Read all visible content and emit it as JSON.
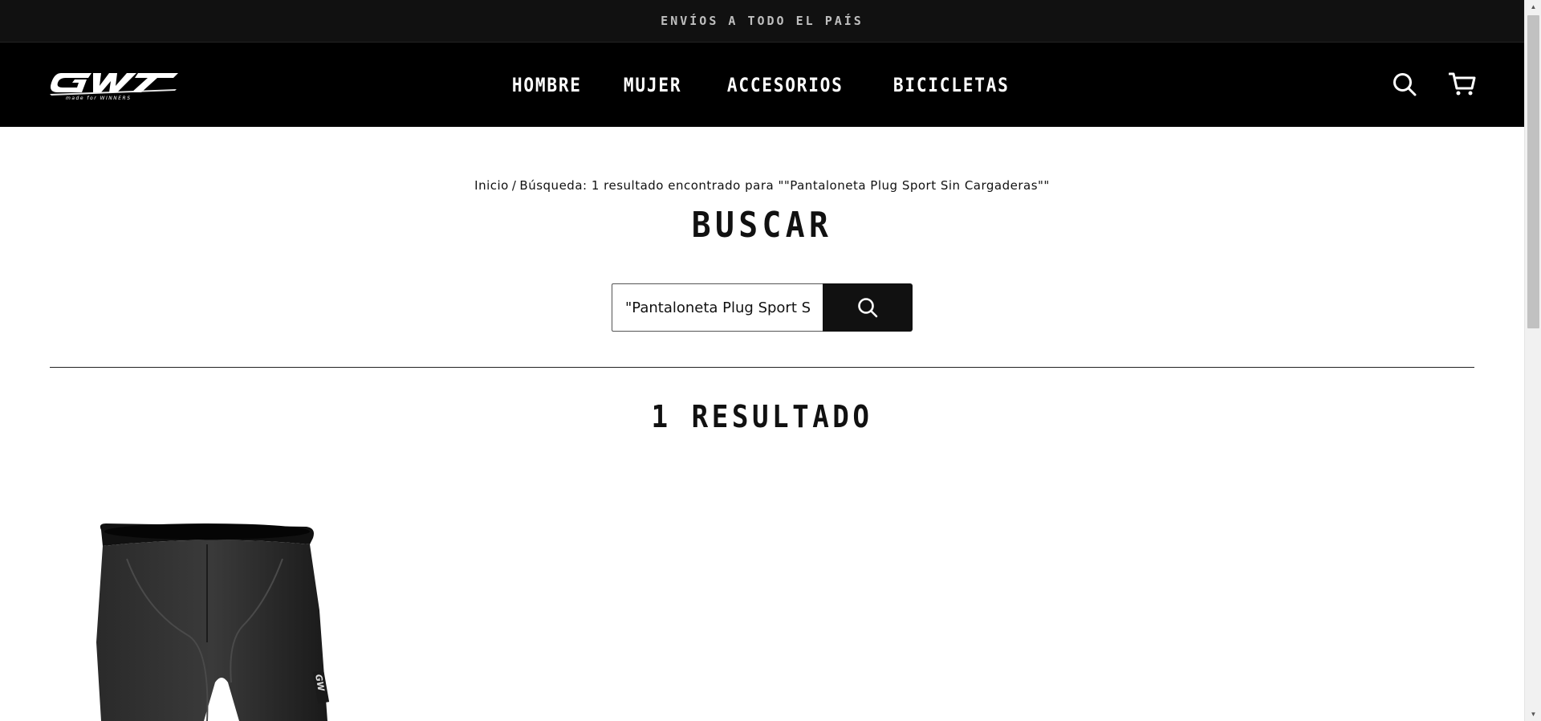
{
  "announcement": {
    "text": "ENVÍOS A TODO EL PAÍS"
  },
  "header": {
    "logo_text": "GW",
    "logo_tagline": "made for WINNERS",
    "nav": [
      {
        "label": "HOMBRE"
      },
      {
        "label": "MUJER"
      },
      {
        "label": "ACCESORIOS"
      },
      {
        "label": "BICICLETAS"
      }
    ],
    "icons": [
      "search-icon",
      "cart-icon"
    ]
  },
  "breadcrumb": {
    "home": "Inicio",
    "separator": "/",
    "current": "Búsqueda: 1 resultado encontrado para \"\"Pantaloneta Plug Sport Sin Cargaderas\"\""
  },
  "main": {
    "title": "BUSCAR",
    "search": {
      "value": "\"Pantaloneta Plug Sport Sin Cargaderas\"",
      "submit_icon": "search-icon"
    },
    "results_count": "1 RESULTADO"
  },
  "colors": {
    "announcement_bg": "#111111",
    "header_bg": "#000000",
    "text": "#111111",
    "button_bg": "#111111"
  }
}
